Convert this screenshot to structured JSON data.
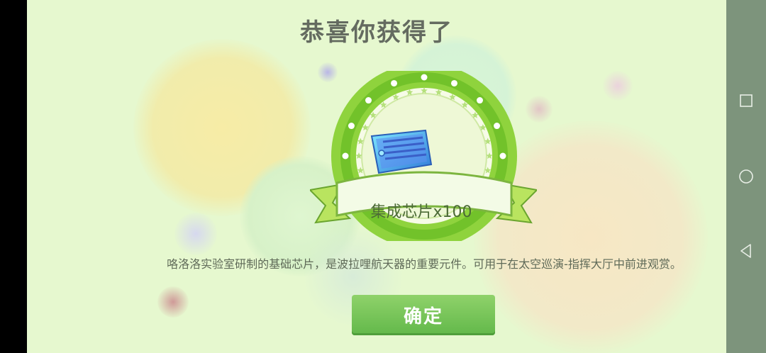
{
  "dialog": {
    "title": "恭喜你获得了",
    "reward_label": "集成芯片x100",
    "description": "咯洛洛实验室研制的基础芯片，是波拉哩航天器的重要元件。可用于在太空巡演-指挥大厅中前进观赏。",
    "confirm_label": "确定",
    "reward_icon": "chip-icon"
  },
  "colors": {
    "background": "#e6f8cf",
    "badge_ring": "#8fd33d",
    "button": "#6dbe50",
    "nav_bar": "#7d947c"
  },
  "system_nav": {
    "icons": [
      "recent-apps-icon",
      "home-icon",
      "back-icon"
    ]
  }
}
